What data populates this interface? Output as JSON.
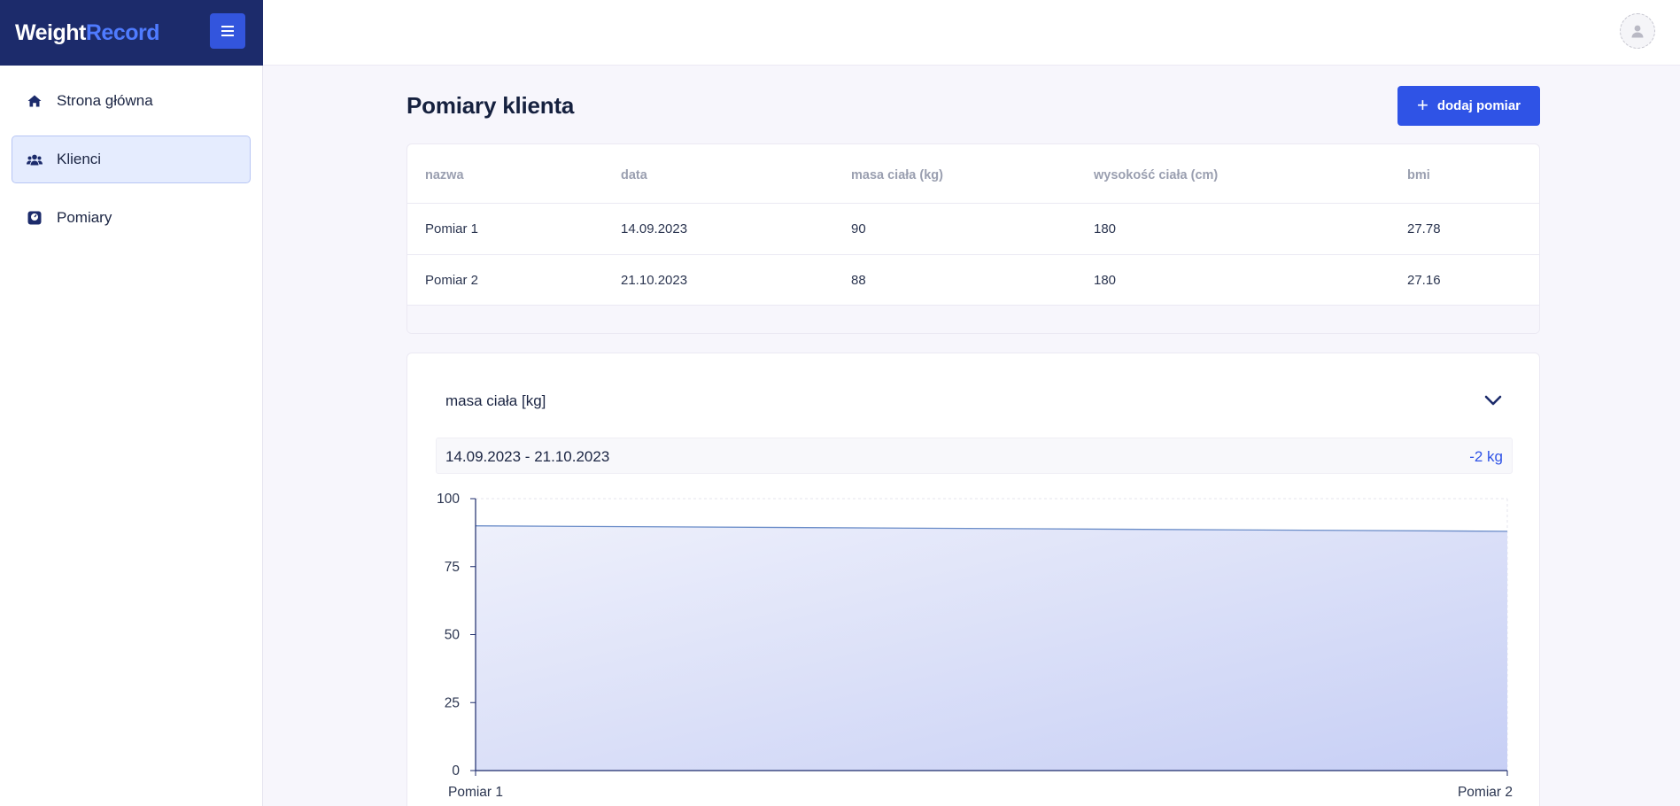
{
  "app": {
    "brand_main": "Weight",
    "brand_accent": "Record"
  },
  "sidebar": {
    "items": [
      {
        "label": "Strona główna",
        "icon": "home-icon"
      },
      {
        "label": "Klienci",
        "icon": "users-icon",
        "active": true
      },
      {
        "label": "Pomiary",
        "icon": "scale-icon"
      }
    ]
  },
  "main": {
    "title": "Pomiary klienta",
    "add_button": "dodaj pomiar",
    "table": {
      "columns": [
        "nazwa",
        "data",
        "masa ciała (kg)",
        "wysokość ciała (cm)",
        "bmi"
      ],
      "rows": [
        [
          "Pomiar 1",
          "14.09.2023",
          "90",
          "180",
          "27.78"
        ],
        [
          "Pomiar 2",
          "21.10.2023",
          "88",
          "180",
          "27.16"
        ]
      ]
    },
    "chart_panel": {
      "select_label": "masa ciała [kg]",
      "range": "14.09.2023 - 21.10.2023",
      "diff": "-2 kg"
    }
  },
  "colors": {
    "accent": "#2f53e6",
    "brand_bg": "#1c2b6b",
    "line": "#6a8cc8"
  },
  "chart_data": {
    "type": "area",
    "categories": [
      "Pomiar 1",
      "Pomiar 2"
    ],
    "series": [
      {
        "values": [
          90,
          88
        ]
      }
    ],
    "ylim": [
      0,
      100
    ],
    "yticks": [
      "0",
      "25",
      "50",
      "75",
      "100"
    ],
    "grid": true
  }
}
